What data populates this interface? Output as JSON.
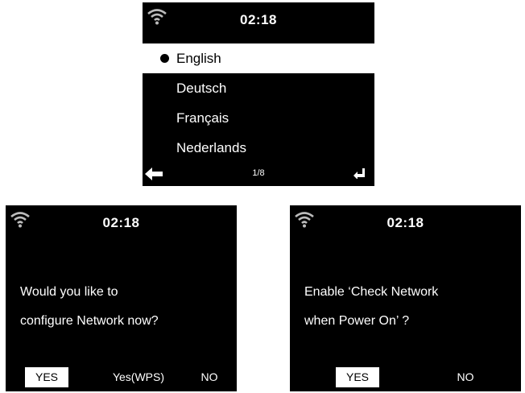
{
  "screens": {
    "language": {
      "time": "02:18",
      "items": [
        {
          "label": "English",
          "selected": true
        },
        {
          "label": "Deutsch",
          "selected": false
        },
        {
          "label": "Français",
          "selected": false
        },
        {
          "label": "Nederlands",
          "selected": false
        }
      ],
      "page_indicator": "1/8",
      "icons": {
        "status": "wifi-icon",
        "back": "back-arrow-icon",
        "enter": "enter-icon"
      }
    },
    "network": {
      "time": "02:18",
      "prompt_line1": "Would you like to",
      "prompt_line2": "configure Network now?",
      "buttons": {
        "yes": "YES",
        "wps": "Yes(WPS)",
        "no": "NO"
      },
      "icons": {
        "status": "wifi-icon"
      }
    },
    "check": {
      "time": "02:18",
      "prompt_line1": "Enable ‘Check Network",
      "prompt_line2": "when Power On’ ?",
      "buttons": {
        "yes": "YES",
        "no": "NO"
      },
      "icons": {
        "status": "wifi-icon"
      }
    }
  },
  "colors": {
    "screen_bg": "#000000",
    "text": "#ffffff",
    "highlight": "#ffffff",
    "page_bg": "#ffffff"
  }
}
